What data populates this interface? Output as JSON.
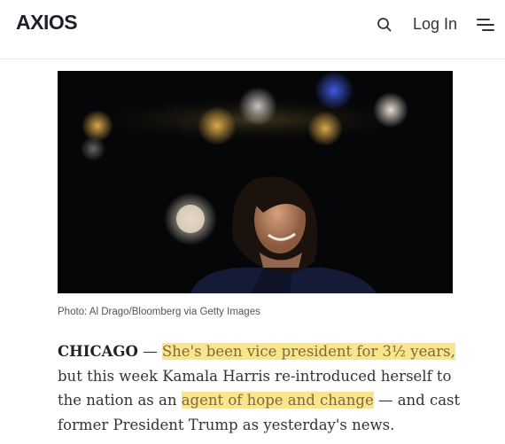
{
  "header": {
    "logo_text": "AXIOS",
    "login_label": "Log In"
  },
  "icons": {
    "search": "search-icon",
    "menu": "menu-icon"
  },
  "photo": {
    "caption": "Photo: Al Drago/Bloomberg via Getty Images"
  },
  "article": {
    "dateline": "CHICAGO",
    "dash": " — ",
    "highlight_1": "She's been vice president for 3½ years,",
    "line_2": "but this week Kamala Harris re-introduced herself to",
    "line_3_pre": "the nation as an ",
    "highlight_2": "agent of hope and change",
    "line_3_post": " — and cast",
    "line_4": "former President Trump as yesterday's news."
  },
  "colors": {
    "highlight": "#fbe58c",
    "text": "#333333",
    "logo": "#1f2029"
  }
}
